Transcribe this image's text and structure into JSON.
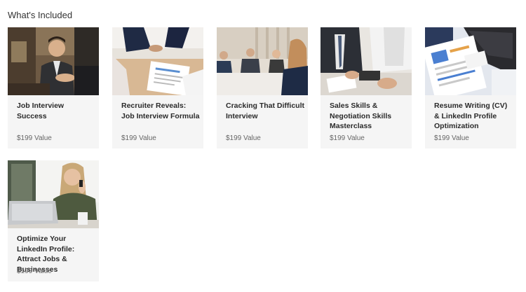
{
  "section": {
    "title": "What's Included"
  },
  "cards": [
    {
      "title": "Job Interview Success",
      "value": "$199 Value",
      "image": "handshake-office-photo"
    },
    {
      "title": "Recruiter Reveals: Job Interview Formula",
      "value": "$199 Value",
      "image": "resume-review-photo"
    },
    {
      "title": "Cracking That Difficult Interview",
      "value": "$199 Value",
      "image": "interview-panel-photo"
    },
    {
      "title": "Sales Skills & Negotiation Skills Masterclass",
      "value": "$199 Value",
      "image": "negotiation-meeting-photo"
    },
    {
      "title": "Resume Writing (CV) & LinkedIn Profile Optimization",
      "value": "$199 Value",
      "image": "cv-laptop-photo"
    },
    {
      "title": "Optimize Your LinkedIn Profile: Attract Jobs & Businesses",
      "value": "$199 Value",
      "image": "woman-laptop-phone-photo"
    }
  ]
}
